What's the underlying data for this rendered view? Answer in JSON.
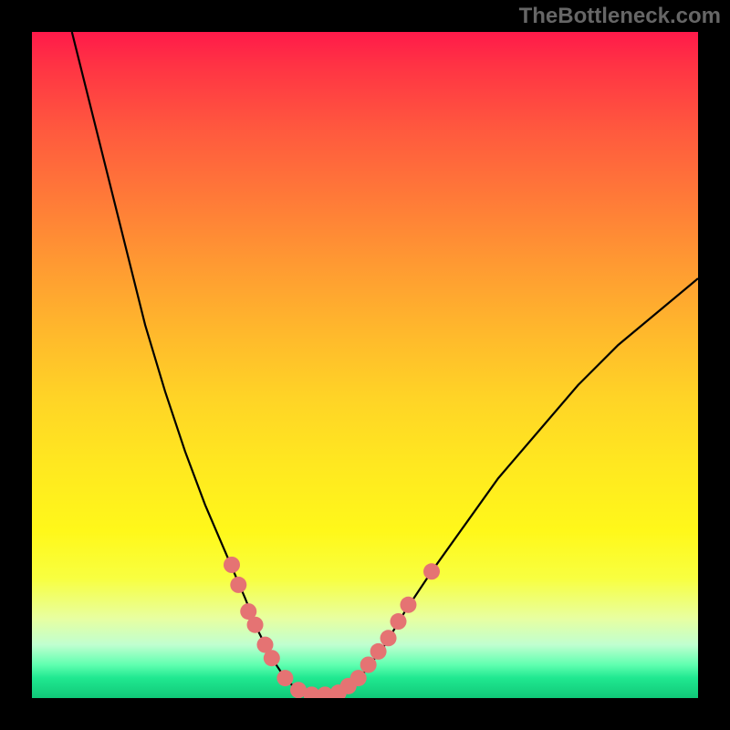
{
  "watermark": "TheBottleneck.com",
  "chart_data": {
    "type": "line",
    "title": "",
    "xlabel": "",
    "ylabel": "",
    "xlim": [
      0,
      100
    ],
    "ylim": [
      0,
      100
    ],
    "curve": {
      "name": "bottleneck-curve",
      "points": [
        {
          "x": 6,
          "y": 100
        },
        {
          "x": 8,
          "y": 92
        },
        {
          "x": 11,
          "y": 80
        },
        {
          "x": 14,
          "y": 68
        },
        {
          "x": 17,
          "y": 56
        },
        {
          "x": 20,
          "y": 46
        },
        {
          "x": 23,
          "y": 37
        },
        {
          "x": 26,
          "y": 29
        },
        {
          "x": 29,
          "y": 22
        },
        {
          "x": 32,
          "y": 15
        },
        {
          "x": 34,
          "y": 10
        },
        {
          "x": 36,
          "y": 6
        },
        {
          "x": 38,
          "y": 3
        },
        {
          "x": 40,
          "y": 1
        },
        {
          "x": 42,
          "y": 0.3
        },
        {
          "x": 44,
          "y": 0.3
        },
        {
          "x": 46,
          "y": 0.5
        },
        {
          "x": 48,
          "y": 2
        },
        {
          "x": 50,
          "y": 4
        },
        {
          "x": 53,
          "y": 8
        },
        {
          "x": 56,
          "y": 13
        },
        {
          "x": 60,
          "y": 19
        },
        {
          "x": 65,
          "y": 26
        },
        {
          "x": 70,
          "y": 33
        },
        {
          "x": 76,
          "y": 40
        },
        {
          "x": 82,
          "y": 47
        },
        {
          "x": 88,
          "y": 53
        },
        {
          "x": 94,
          "y": 58
        },
        {
          "x": 100,
          "y": 63
        }
      ]
    },
    "markers": {
      "name": "highlight-points",
      "color": "#e57373",
      "points": [
        {
          "x": 30,
          "y": 20
        },
        {
          "x": 31,
          "y": 17
        },
        {
          "x": 32.5,
          "y": 13
        },
        {
          "x": 33.5,
          "y": 11
        },
        {
          "x": 35,
          "y": 8
        },
        {
          "x": 36,
          "y": 6
        },
        {
          "x": 38,
          "y": 3
        },
        {
          "x": 40,
          "y": 1.2
        },
        {
          "x": 42,
          "y": 0.5
        },
        {
          "x": 44,
          "y": 0.5
        },
        {
          "x": 46,
          "y": 0.8
        },
        {
          "x": 47.5,
          "y": 1.8
        },
        {
          "x": 49,
          "y": 3
        },
        {
          "x": 50.5,
          "y": 5
        },
        {
          "x": 52,
          "y": 7
        },
        {
          "x": 53.5,
          "y": 9
        },
        {
          "x": 55,
          "y": 11.5
        },
        {
          "x": 56.5,
          "y": 14
        },
        {
          "x": 60,
          "y": 19
        }
      ]
    },
    "gradient_stops": [
      {
        "pos": 0,
        "color": "#ff1a4a"
      },
      {
        "pos": 50,
        "color": "#ffd426"
      },
      {
        "pos": 85,
        "color": "#fff81a"
      },
      {
        "pos": 100,
        "color": "#10c878"
      }
    ]
  }
}
